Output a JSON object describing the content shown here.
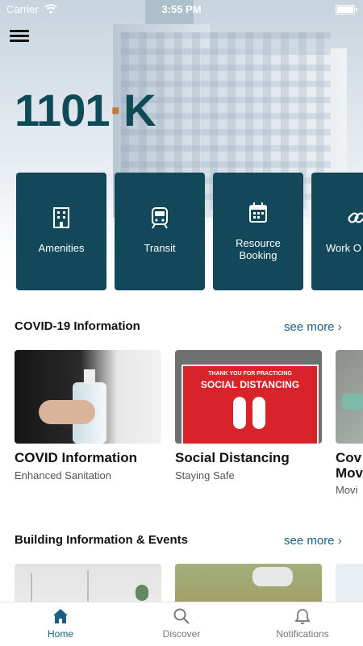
{
  "status_bar": {
    "carrier": "Carrier",
    "time": "3:55 PM"
  },
  "brand": {
    "logo_text": "1101",
    "logo_dot": "·",
    "logo_k": "K",
    "color": "#12485a",
    "accent": "#c47a38"
  },
  "tiles": [
    {
      "label": "Amenities",
      "icon": "building-icon"
    },
    {
      "label": "Transit",
      "icon": "train-icon"
    },
    {
      "label": "Resource Booking",
      "icon": "calendar-icon"
    },
    {
      "label": "Work O",
      "icon": "link-icon"
    }
  ],
  "sections": [
    {
      "title": "COVID-19 Information",
      "see_more": "see more ›",
      "cards": [
        {
          "title": "COVID Information",
          "subtitle": "Enhanced Sanitation"
        },
        {
          "title": "Social Distancing",
          "subtitle": "Staying Safe",
          "sign_top": "THANK YOU FOR PRACTICING",
          "sign_main": "SOCIAL DISTANCING"
        },
        {
          "title": "Cov",
          "title2": "Mov",
          "subtitle": "Movi"
        }
      ]
    },
    {
      "title": "Building Information & Events",
      "see_more": "see more ›",
      "cards": []
    }
  ],
  "tabbar": [
    {
      "label": "Home",
      "icon": "home-icon",
      "active": true
    },
    {
      "label": "Discover",
      "icon": "search-icon",
      "active": false
    },
    {
      "label": "Notifications",
      "icon": "bell-icon",
      "active": false
    }
  ]
}
